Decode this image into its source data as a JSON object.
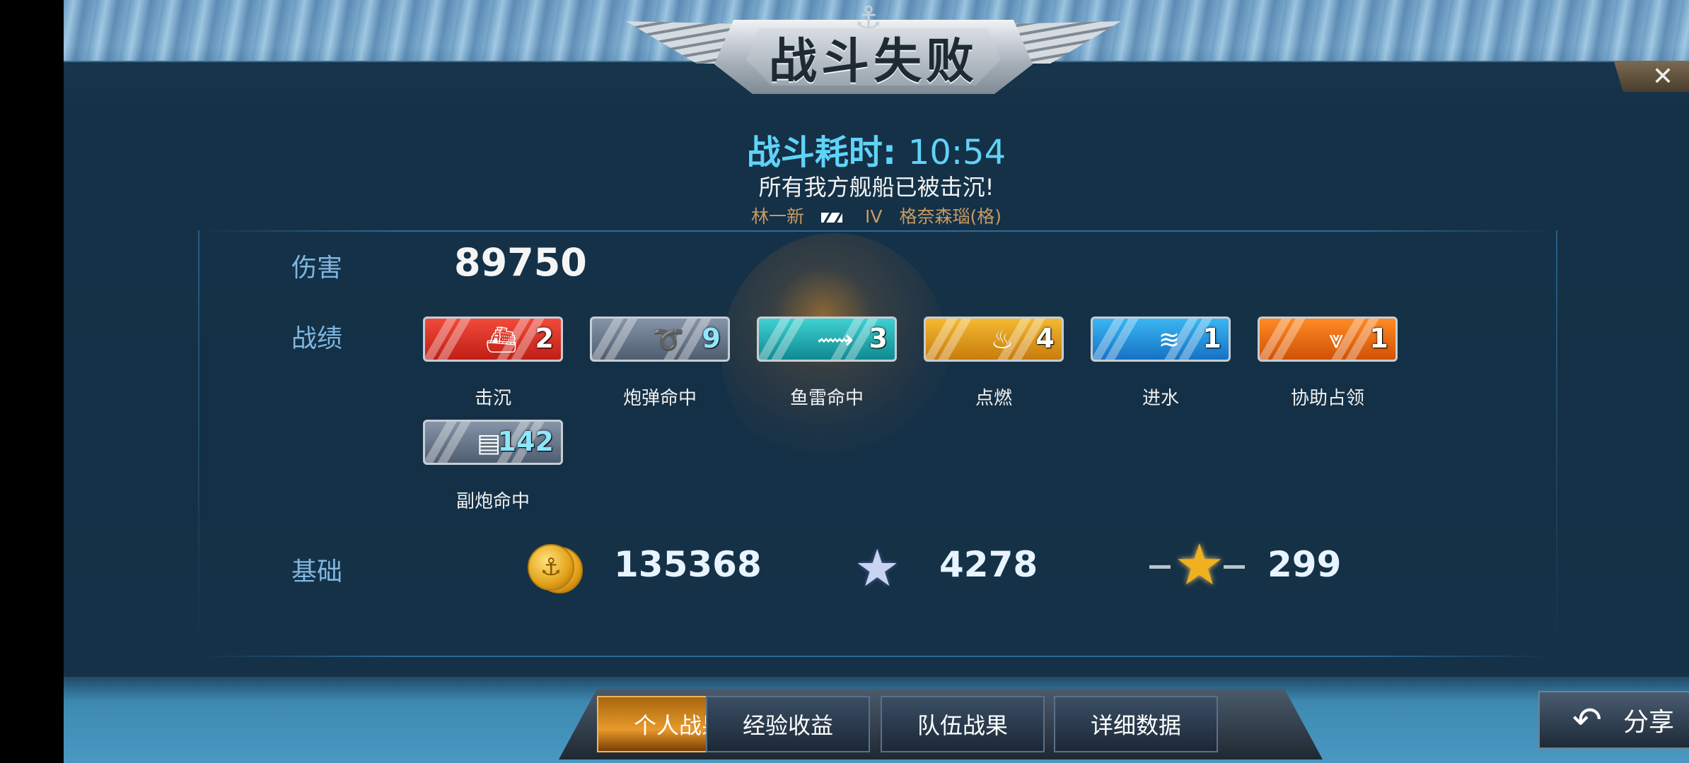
{
  "header": {
    "title": "战斗失败",
    "close_label": "✕"
  },
  "battle": {
    "time_label": "战斗耗时: ",
    "time_value": "10:54",
    "result_message": "所有我方舰船已被击沉!",
    "player_name": "林一新",
    "ship_tier": "IV",
    "ship_name": "格奈森瑙(格)"
  },
  "labels": {
    "damage": "伤害",
    "achievements": "战绩",
    "base": "基础"
  },
  "damage_value": "89750",
  "achievements": [
    {
      "label": "击沉",
      "count": "2",
      "color": "red",
      "icon": "sunk-ship-icon"
    },
    {
      "label": "炮弹命中",
      "count": "9",
      "color": "gray",
      "icon": "shell-hit-icon"
    },
    {
      "label": "鱼雷命中",
      "count": "3",
      "color": "teal",
      "icon": "torpedo-hit-icon"
    },
    {
      "label": "点燃",
      "count": "4",
      "color": "gold",
      "icon": "fire-icon"
    },
    {
      "label": "进水",
      "count": "1",
      "color": "blue",
      "icon": "flooding-icon"
    },
    {
      "label": "协助占领",
      "count": "1",
      "color": "orange",
      "icon": "capture-assist-icon"
    },
    {
      "label": "副炮命中",
      "count": "142",
      "color": "gray",
      "icon": "secondary-gun-icon"
    }
  ],
  "base_rewards": {
    "credits": "135368",
    "experience": "4278",
    "free_experience": "299"
  },
  "tabs": [
    {
      "label": "个人战果",
      "active": true
    },
    {
      "label": "经验收益",
      "active": false
    },
    {
      "label": "队伍战果",
      "active": false
    },
    {
      "label": "详细数据",
      "active": false
    }
  ],
  "share_label": "分享"
}
